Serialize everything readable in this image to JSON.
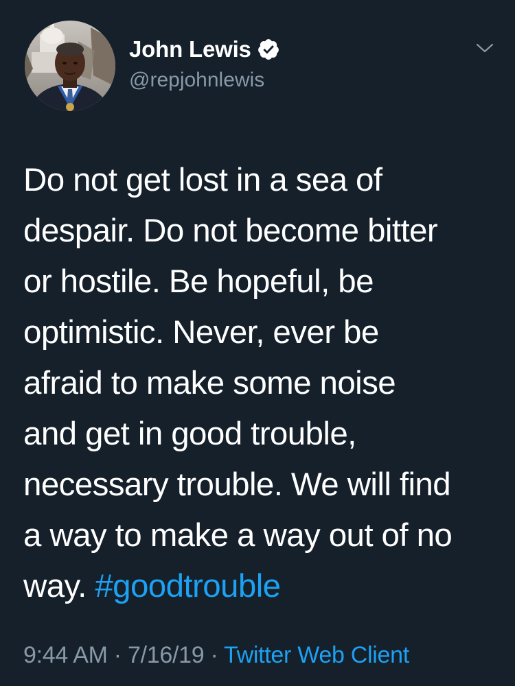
{
  "author": {
    "display_name": "John Lewis",
    "handle": "@repjohnlewis",
    "verified": true,
    "avatar_icon": "profile-photo-avatar"
  },
  "tweet": {
    "text": "Do not get lost in a sea of\ndespair. Do not become bitter\nor hostile. Be hopeful, be\noptimistic. Never, ever be\nafraid to make some noise\nand get in good trouble,\nnecessary trouble. We will find\na way to make a way out of no\nway. ",
    "hashtag": "#goodtrouble"
  },
  "meta": {
    "time": "9:44 AM",
    "separator": " · ",
    "date": "7/16/19",
    "client": "Twitter Web Client"
  },
  "colors": {
    "background": "#15202b",
    "text": "#ffffff",
    "secondary": "#8899a6",
    "accent": "#1da1f2"
  },
  "icons": {
    "verified": "verified-badge-icon",
    "menu": "chevron-down-icon"
  }
}
